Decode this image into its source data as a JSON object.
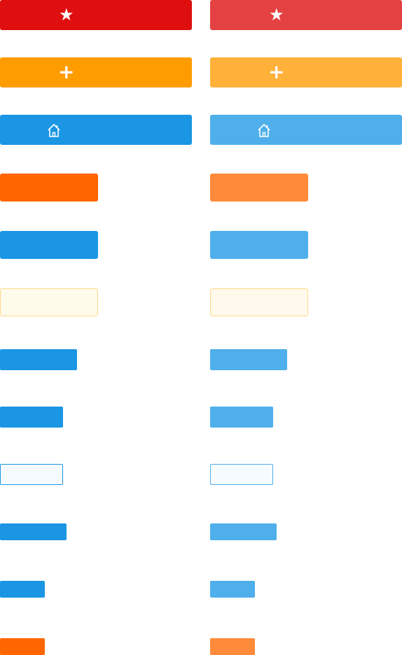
{
  "colors": {
    "red": "#df0f0f",
    "red_light": "#e44242",
    "orange": "#ff9c00",
    "orange_light": "#ffb13a",
    "blue": "#1a96e4",
    "blue_light": "#4fafeb",
    "deep_orange": "#ff6600",
    "deep_orange_light": "#ff8a3a",
    "cream_bg": "#fffbeb",
    "cream_border": "#ffd98a",
    "outline_bg": "#f5fbff",
    "outline_border": "#1a96e4"
  },
  "icons": {
    "star": "★",
    "plus": "+",
    "home": "home-icon"
  }
}
